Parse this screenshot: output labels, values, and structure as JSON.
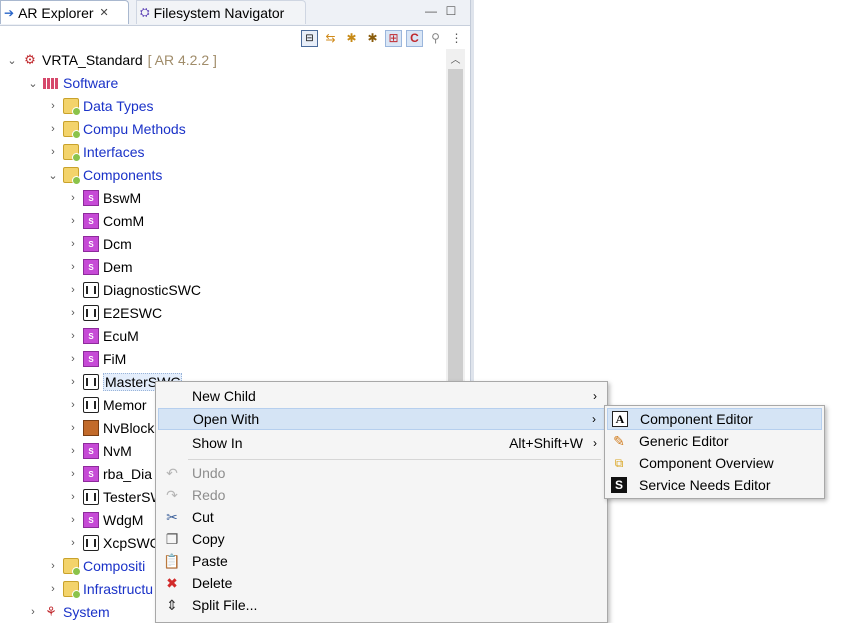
{
  "tabs": [
    {
      "label": "AR Explorer",
      "icon": "ar-explorer-icon",
      "active": true
    },
    {
      "label": "Filesystem Navigator",
      "icon": "filesystem-navigator-icon",
      "active": false
    }
  ],
  "toolbar": {
    "icons": [
      "collapse-all-icon",
      "link-with-editor-icon",
      "filter-icon",
      "filter-alt-icon",
      "grid-icon",
      "refresh-icon",
      "satellite-icon",
      "view-menu-icon"
    ]
  },
  "tree": {
    "project": {
      "name": "VRTA_Standard",
      "version": "[ AR 4.2.2 ]"
    },
    "software": "Software",
    "software_children": [
      "Data Types",
      "Compu Methods",
      "Interfaces",
      "Components"
    ],
    "components": [
      "BswM",
      "ComM",
      "Dcm",
      "Dem",
      "DiagnosticSWC",
      "E2ESWC",
      "EcuM",
      "FiM",
      "MasterSWC",
      "Memor",
      "NvBlock",
      "NvM",
      "rba_Dia",
      "TesterSW",
      "WdgM",
      "XcpSWC"
    ],
    "component_icons": [
      "purple",
      "purple",
      "purple",
      "purple",
      "gray",
      "gray",
      "purple",
      "purple",
      "gray",
      "gray",
      "orange",
      "purple",
      "purple",
      "gray",
      "purple",
      "gray"
    ],
    "after_components": [
      "Compositi",
      "Infrastructu"
    ],
    "system": "System"
  },
  "context_menu": {
    "items": [
      {
        "label": "New Child",
        "icon": "",
        "accelerator": "",
        "submenu": true,
        "disabled": false
      },
      {
        "label": "Open With",
        "icon": "",
        "accelerator": "",
        "submenu": true,
        "disabled": false
      },
      {
        "label": "Show In",
        "icon": "",
        "accelerator": "Alt+Shift+W",
        "submenu": true,
        "disabled": false
      },
      {
        "label": "Undo",
        "icon": "undo-icon",
        "accelerator": "",
        "submenu": false,
        "disabled": true
      },
      {
        "label": "Redo",
        "icon": "redo-icon",
        "accelerator": "",
        "submenu": false,
        "disabled": true
      },
      {
        "label": "Cut",
        "icon": "scissors-icon",
        "accelerator": "",
        "submenu": false,
        "disabled": false
      },
      {
        "label": "Copy",
        "icon": "copy-icon",
        "accelerator": "",
        "submenu": false,
        "disabled": false
      },
      {
        "label": "Paste",
        "icon": "paste-icon",
        "accelerator": "",
        "submenu": false,
        "disabled": false
      },
      {
        "label": "Delete",
        "icon": "delete-icon",
        "accelerator": "",
        "submenu": false,
        "disabled": false
      },
      {
        "label": "Split File...",
        "icon": "split-file-icon",
        "accelerator": "",
        "submenu": false,
        "disabled": false
      }
    ]
  },
  "open_with_submenu": {
    "items": [
      {
        "label": "Component Editor",
        "icon": "component-editor-icon"
      },
      {
        "label": "Generic Editor",
        "icon": "generic-editor-icon"
      },
      {
        "label": "Component Overview",
        "icon": "component-overview-icon"
      },
      {
        "label": "Service Needs Editor",
        "icon": "service-needs-editor-icon"
      }
    ]
  },
  "colors": {
    "link": "#1a32c8",
    "highlight": "#d5e4f5",
    "component_purple": "#c64ad6",
    "version_gray": "#a08c6a"
  }
}
